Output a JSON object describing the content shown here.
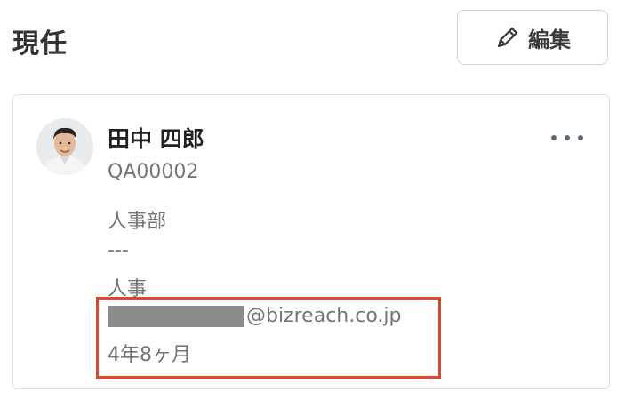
{
  "section": {
    "title": "現任"
  },
  "edit_button": {
    "label": "編集",
    "icon": "pencil-icon"
  },
  "employee": {
    "name": "田中 四郎",
    "id": "QA00002",
    "department": "人事部",
    "placeholder": "---",
    "role": "人事",
    "email_domain": "@bizreach.co.jp",
    "tenure": "4年8ヶ月"
  },
  "more_menu": {
    "icon": "more-horizontal-icon"
  },
  "colors": {
    "highlight": "#e0452e",
    "text_muted": "#757575",
    "border": "#dcdfe2"
  }
}
